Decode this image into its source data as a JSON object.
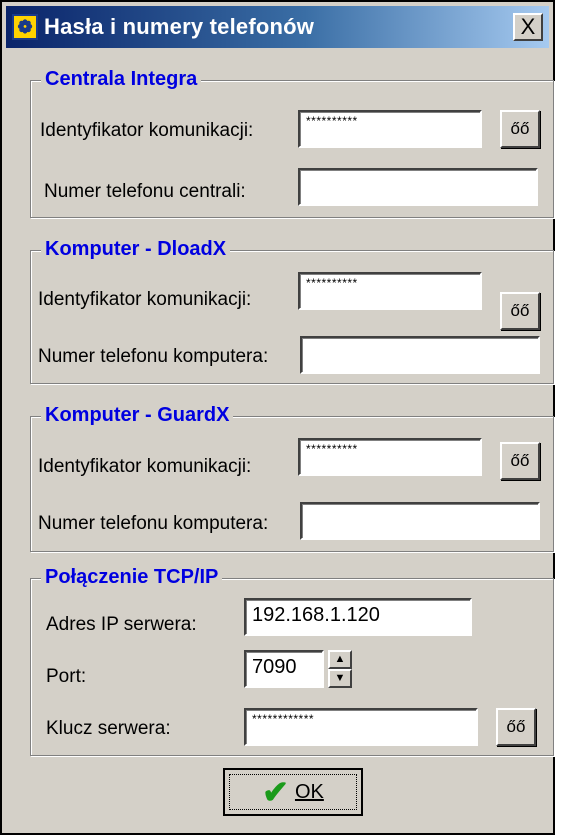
{
  "window": {
    "title": "Hasła i numery telefonów",
    "close_label": "X",
    "app_icon_glyph": "❁"
  },
  "groups": [
    {
      "title": "Centrala Integra",
      "label1": "Identyfikator komunikacji:",
      "value1": "**********",
      "label2": "Numer telefonu centrali:",
      "value2": ""
    },
    {
      "title": "Komputer - DloadX",
      "label1": "Identyfikator komunikacji:",
      "value1": "**********",
      "label2": "Numer telefonu komputera:",
      "value2": ""
    },
    {
      "title": "Komputer - GuardX",
      "label1": "Identyfikator komunikacji:",
      "value1": "**********",
      "label2": "Numer telefonu komputera:",
      "value2": ""
    }
  ],
  "tcp": {
    "title": "Połączenie TCP/IP",
    "ip_label": "Adres IP serwera:",
    "ip_value": "192.168.1.120",
    "port_label": "Port:",
    "port_value": "7090",
    "key_label": "Klucz serwera:",
    "key_value": "************"
  },
  "show_button_glyph": "őő",
  "ok_label": "OK",
  "ok_icon": "✔"
}
